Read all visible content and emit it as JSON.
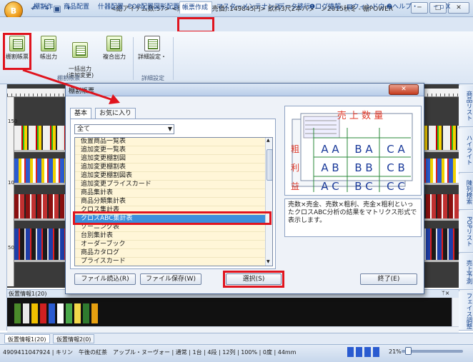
{
  "window": {
    "title": "<総アイテム数:57> <総在庫金額(売価):149845円> 飲料3尺2本パターン2015秋冬 - 棚POWER",
    "app_orb_label": "B",
    "controls": [
      "─",
      "□",
      "✕"
    ]
  },
  "ribbon_tabs": [
    "棚割作",
    "商品配置",
    "什器配置",
    "POP配置",
    "図形配置",
    "帳票作成",
    "マスターメンテナンス",
    "データ移行",
    "❶ログ情報",
    "▤ウィンドウ・",
    "❷ヘルプ・",
    "─ ▫ X"
  ],
  "active_tab": "帳票作成",
  "ribbon": {
    "buttons": [
      "棚割帳票",
      "帳出力",
      "一括出力\n(追加変更)",
      "複合出力",
      "詳細設定・"
    ],
    "groups": [
      "棚割帳票",
      "詳細設定"
    ]
  },
  "ruler_labels": [
    "150",
    "100",
    "50"
  ],
  "right_rail": [
    "商品リスト",
    "ハイライト",
    "陳列検索",
    "POPリスト",
    "売上予測",
    "フェイス調整"
  ],
  "lower_pane": {
    "header": "仮置情報1(20)",
    "pin": "ᛘ×"
  },
  "bottom_tabs": [
    "仮置情報1(20)",
    "仮置情報2(0)"
  ],
  "status": {
    "text": "4909411047924 | キリン　午後の紅茶　アップル・ヌーヴォー | 通常 | 1台 | 4段 | 12列 | 100% | 0度 | 44mm",
    "zoom": "21%"
  },
  "dialog": {
    "title": "棚割帳票",
    "close": "✕",
    "tabs": [
      "基本",
      "お気に入り"
    ],
    "filter_value": "全て",
    "items": [
      "仮置商品一覧表",
      "追加変更一覧表",
      "追加変更棚割図",
      "追加変更棚割表",
      "追加変更棚割図表",
      "追加変更プライスカード",
      "商品集計表",
      "商品分類集計表",
      "クロス集計表",
      "クロスABC集計表",
      "ゾーニング表",
      "台別集計表",
      "オーダーブック",
      "商品カタログ",
      "プライスカード"
    ],
    "selected_item": "クロスABC集計表",
    "preview": {
      "header": "売 上 数 量",
      "side_label": [
        "粗",
        "利",
        "益"
      ],
      "cells": [
        [
          "A A",
          "B A",
          "C A"
        ],
        [
          "A B",
          "B B",
          "C B"
        ],
        [
          "A C",
          "B C",
          "C C"
        ]
      ]
    },
    "description": "売数×売金、売数×粗利、売金×粗利といったクロスABC分析の結果をマトリクス形式で表示します。",
    "buttons": {
      "load": "ファイル読込(R)",
      "save": "ファイル保存(W)",
      "select": "選択(S)",
      "close": "終了(E)"
    }
  },
  "colors": {
    "highlight_red": "#e0141e",
    "selection_blue": "#3c8fdc",
    "list_row": "#fff6d8"
  }
}
